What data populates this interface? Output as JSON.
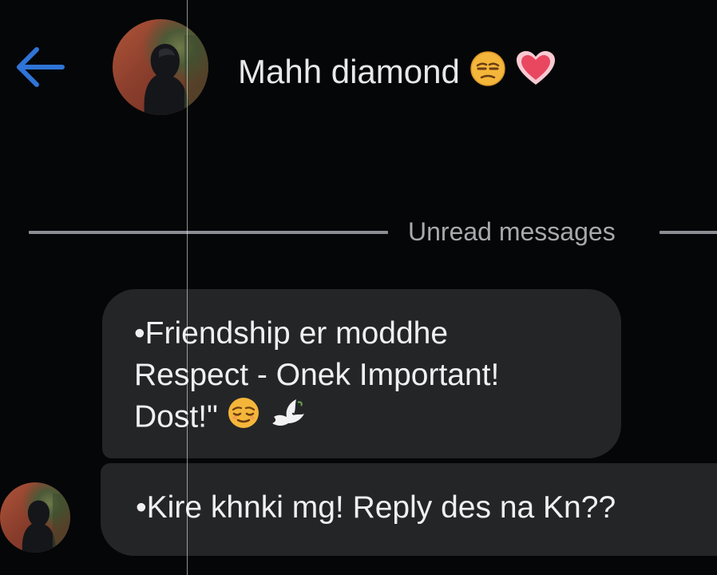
{
  "header": {
    "contact_name": "Mahh diamond",
    "name_emojis": [
      "unamused-face-emoji",
      "heart-emoji"
    ]
  },
  "divider": {
    "label": "Unread messages"
  },
  "messages": [
    {
      "lines": [
        "•Friendship er moddhe",
        "Respect - Onek Important!",
        "Dost!\""
      ],
      "trailing_emojis": [
        "relieved-face-emoji",
        "dove-emoji"
      ]
    },
    {
      "lines": [
        "•Kire khnki mg! Reply des na Kn??"
      ]
    }
  ],
  "colors": {
    "background": "#050608",
    "bubble": "#242527",
    "accent_back_arrow": "#2f74d6",
    "divider": "#8b8d92"
  }
}
